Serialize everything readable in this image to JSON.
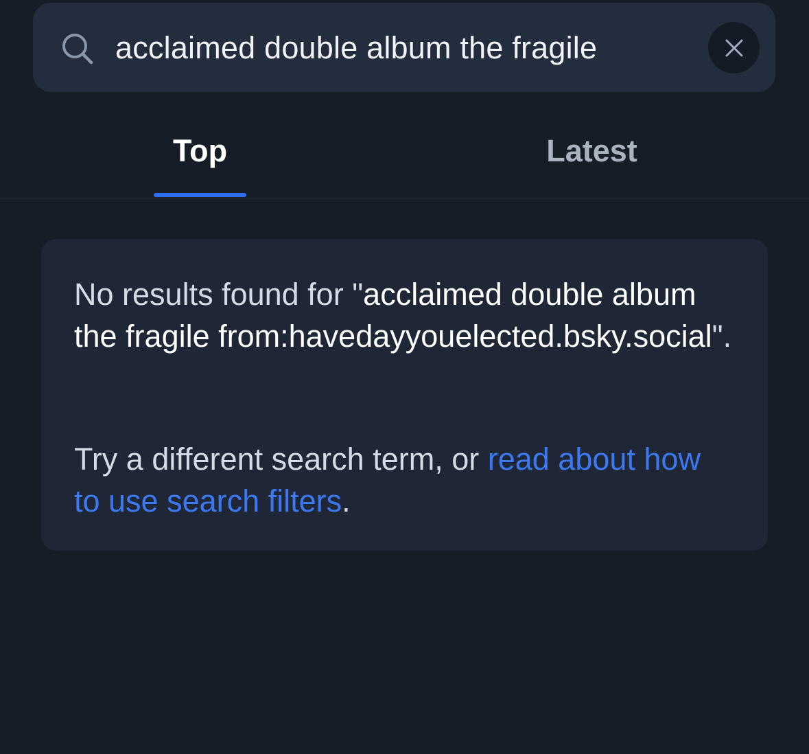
{
  "search": {
    "query": "acclaimed double album the fragile"
  },
  "tabs": [
    {
      "label": "Top",
      "selected": true
    },
    {
      "label": "Latest",
      "selected": false
    }
  ],
  "empty_state": {
    "prefix": "No results found for \"",
    "query": "acclaimed double album the fragile from:havedayyouelected.bsky.social",
    "suffix": "\".",
    "hint_prefix": "Try a different search term, or ",
    "hint_link": "read about how to use search filters",
    "hint_suffix": "."
  },
  "colors": {
    "background": "#161d27",
    "surface": "#232d3e",
    "card": "#1f2737",
    "accent": "#2f6fef",
    "link": "#3c79f0"
  },
  "icons": {
    "search": "search-icon",
    "clear": "close-icon"
  }
}
